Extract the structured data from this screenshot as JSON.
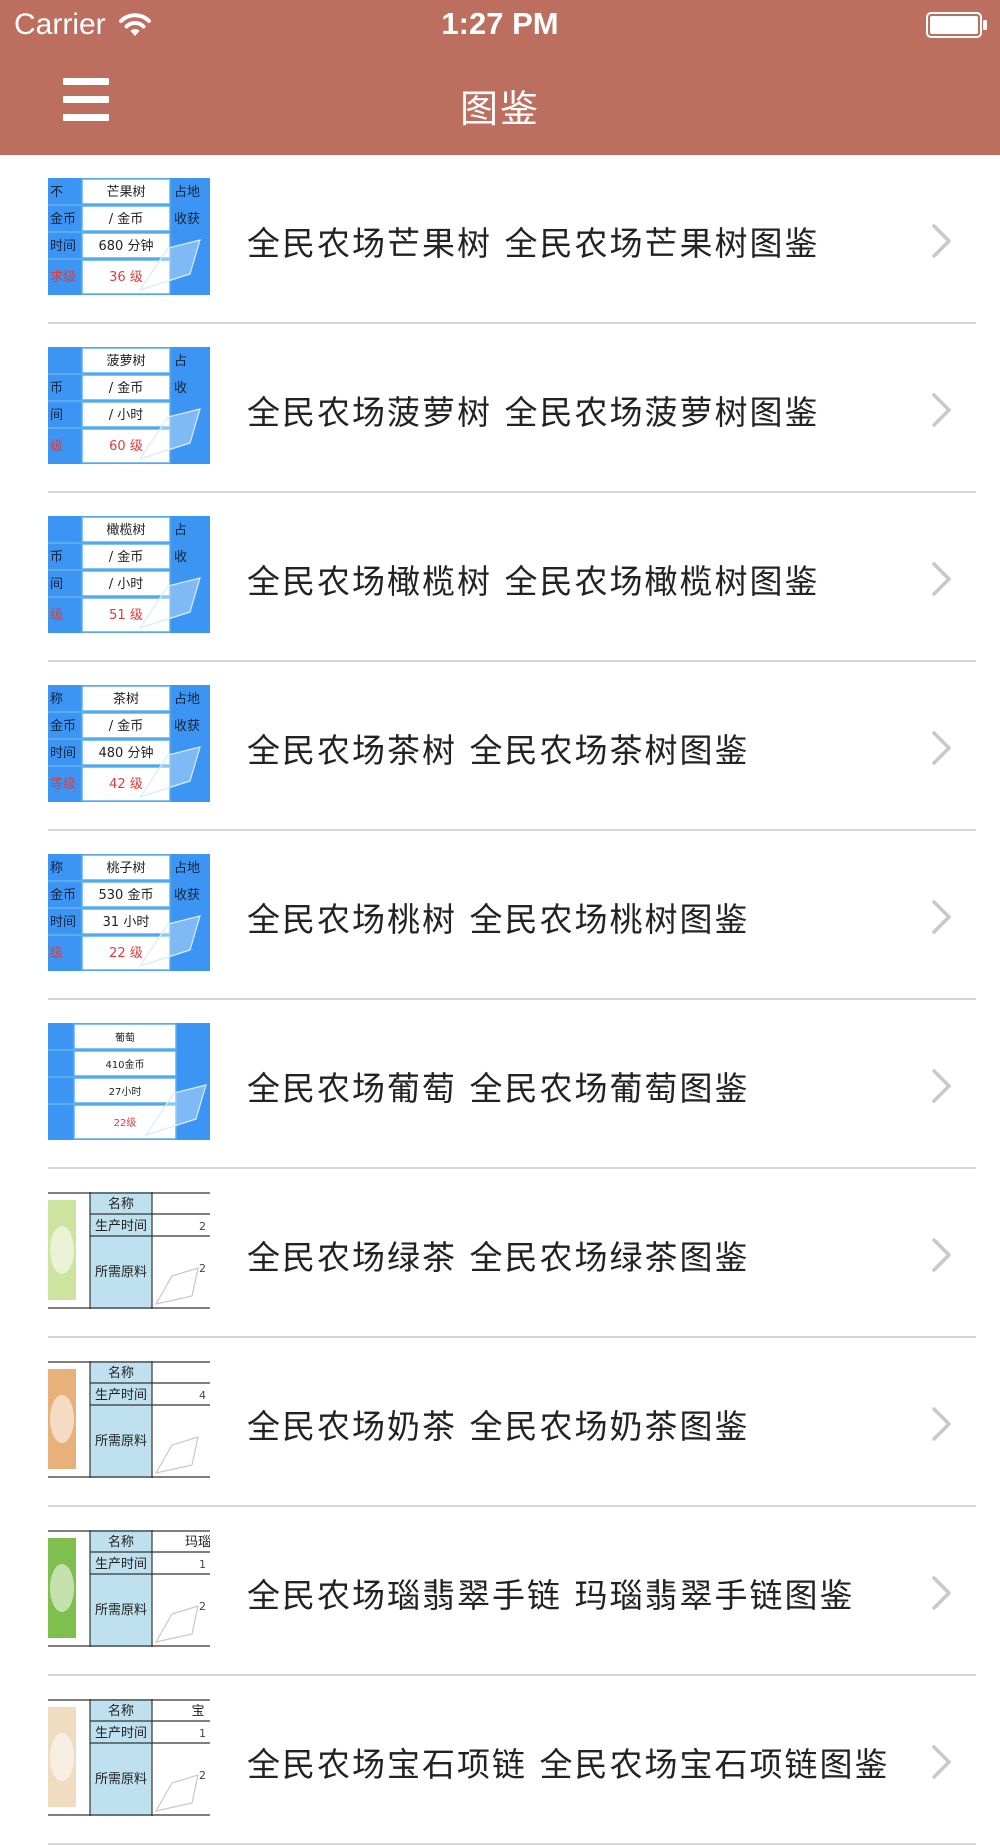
{
  "status_bar": {
    "carrier": "Carrier",
    "time": "1:27 PM",
    "wifi_icon": "wifi-icon",
    "battery_icon": "battery-icon"
  },
  "nav_bar": {
    "title": "图鉴",
    "menu_icon": "hamburger-menu-icon",
    "background_color": "#bd6f5f"
  },
  "list": {
    "items": [
      {
        "label": "全民农场芒果树 全民农场芒果树图鉴",
        "thumb": {
          "kind": "blue",
          "name": "芒果树",
          "row2": "/ 金币",
          "row3": "680 分钟",
          "level": "36 级",
          "left1": "不",
          "left2": "金币",
          "left3": "时间",
          "left4": "求级",
          "right1": "占地",
          "right2": "收获"
        }
      },
      {
        "label": "全民农场菠萝树 全民农场菠萝树图鉴",
        "thumb": {
          "kind": "blue",
          "name": "菠萝树",
          "row2": "/ 金币",
          "row3": "/ 小时",
          "level": "60 级",
          "left1": "",
          "left2": "币",
          "left3": "间",
          "left4": "级",
          "right1": "占",
          "right2": "收"
        }
      },
      {
        "label": "全民农场橄榄树 全民农场橄榄树图鉴",
        "thumb": {
          "kind": "blue",
          "name": "橄榄树",
          "row2": "/ 金币",
          "row3": "/ 小时",
          "level": "51 级",
          "left1": "",
          "left2": "币",
          "left3": "间",
          "left4": "级",
          "right1": "占",
          "right2": "收"
        }
      },
      {
        "label": "全民农场茶树 全民农场茶树图鉴",
        "thumb": {
          "kind": "blue",
          "name": "茶树",
          "row2": "/ 金币",
          "row3": "480 分钟",
          "level": "42 级",
          "left1": "称",
          "left2": "金币",
          "left3": "时间",
          "left4": "等级",
          "right1": "占地",
          "right2": "收获"
        }
      },
      {
        "label": "全民农场桃树 全民农场桃树图鉴",
        "thumb": {
          "kind": "blue",
          "name": "桃子树",
          "row2": "530 金币",
          "row3": "31 小时",
          "level": "22 级",
          "left1": "称",
          "left2": "金币",
          "left3": "时间",
          "left4": "级",
          "right1": "占地",
          "right2": "收获"
        }
      },
      {
        "label": "全民农场葡萄 全民农场葡萄图鉴",
        "thumb": {
          "kind": "blue2",
          "name": "葡萄",
          "row2": "410金币",
          "row3": "27小时",
          "level": "22级"
        }
      },
      {
        "label": "全民农场绿茶 全民农场绿茶图鉴",
        "thumb": {
          "kind": "table",
          "r1": "名称",
          "r2": "生产时间",
          "r3": "所需原料",
          "c1": "",
          "c2": "2",
          "c3": "2",
          "pic": "#cfe3a0"
        }
      },
      {
        "label": "全民农场奶茶 全民农场奶茶图鉴",
        "thumb": {
          "kind": "table",
          "r1": "名称",
          "r2": "生产时间",
          "r3": "所需原料",
          "c1": "",
          "c2": "4",
          "c3": "",
          "pic": "#e8b07a"
        }
      },
      {
        "label": "全民农场瑙翡翠手链 玛瑙翡翠手链图鉴",
        "thumb": {
          "kind": "table",
          "r1": "名称",
          "r2": "生产时间",
          "r3": "所需原料",
          "c1": "玛瑙",
          "c2": "1",
          "c3": "2",
          "pic": "#7fbf4d"
        }
      },
      {
        "label": "全民农场宝石项链 全民农场宝石项链图鉴",
        "thumb": {
          "kind": "table",
          "r1": "名称",
          "r2": "生产时间",
          "r3": "所需原料",
          "c1": "宝",
          "c2": "1",
          "c3": "2",
          "pic": "#f0dcc0"
        }
      }
    ]
  },
  "chevron_icon": "chevron-right-icon",
  "colors": {
    "accent": "#bd6f5f",
    "thumb_blue": "#3c95f2",
    "thumb_level_red": "#e23b3b",
    "thumb_table_cell": "#bfe0ee"
  }
}
